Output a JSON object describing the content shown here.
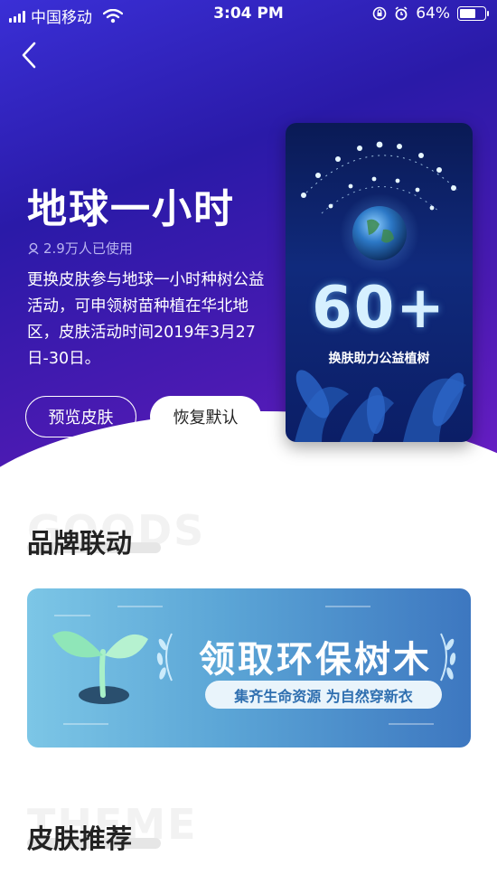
{
  "status_bar": {
    "carrier": "中国移动",
    "time": "3:04 PM",
    "battery_percent": "64%",
    "battery_level": 0.64
  },
  "hero": {
    "title": "地球一小时",
    "users_count": "2.9万人已使用",
    "description": "更换皮肤参与地球一小时种树公益活动，可申领树苗种植在华北地区，皮肤活动时间2019年3月27日-30日。",
    "preview_button": "预览皮肤",
    "restore_button": "恢复默认",
    "colors": {
      "gradient_start": "#3a2fd6",
      "gradient_end": "#6a1ec6"
    }
  },
  "poster": {
    "number": "60+",
    "caption": "换肤助力公益植树"
  },
  "sections": {
    "brand": {
      "bg_word": "GOODS",
      "title": "品牌联动"
    },
    "theme": {
      "bg_word": "THEME",
      "title": "皮肤推荐"
    }
  },
  "banner": {
    "title": "领取环保树木",
    "subtitle": "集齐生命资源 为自然穿新衣"
  }
}
